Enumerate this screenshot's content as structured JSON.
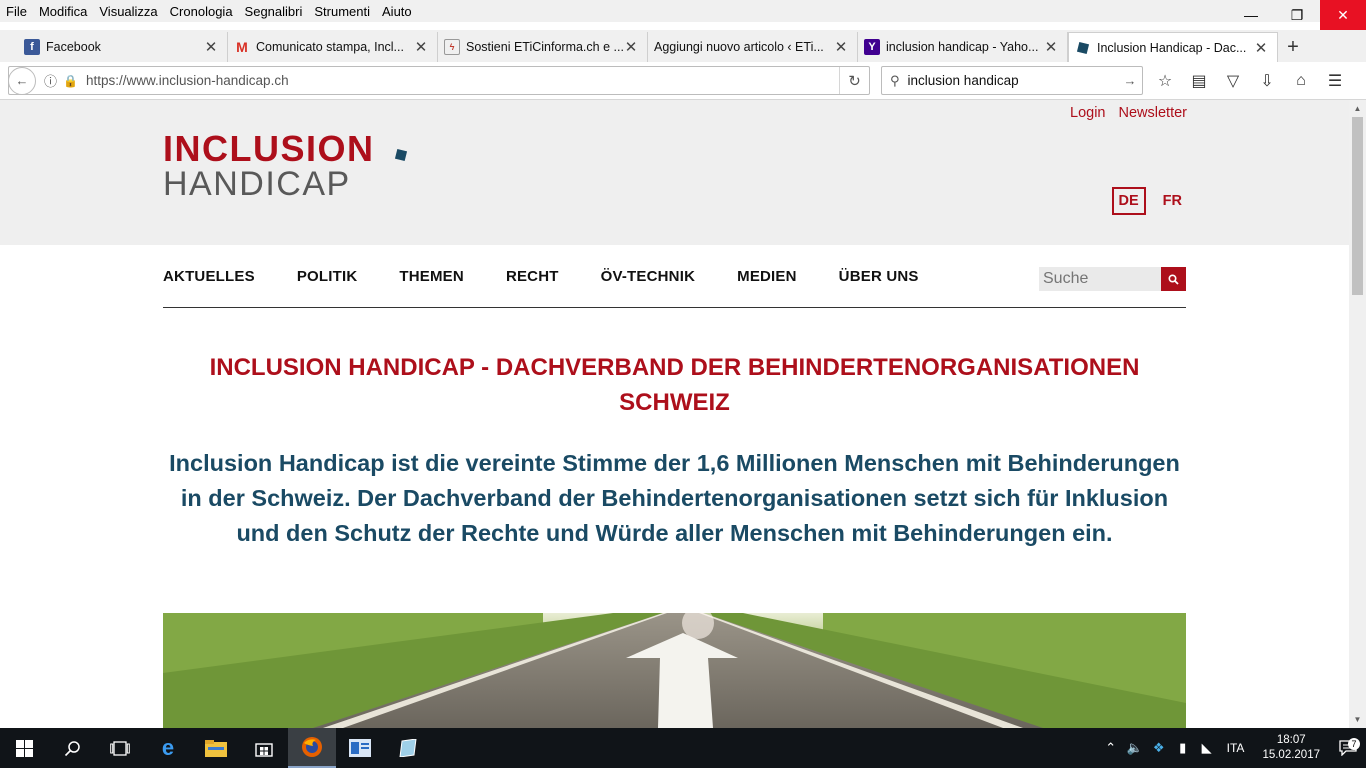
{
  "menu": [
    "File",
    "Modifica",
    "Visualizza",
    "Cronologia",
    "Segnalibri",
    "Strumenti",
    "Aiuto"
  ],
  "tabs": [
    {
      "label": "Facebook",
      "icon": "facebook-icon"
    },
    {
      "label": "Comunicato stampa, Incl...",
      "icon": "gmail-icon"
    },
    {
      "label": "Sostieni ETiCinforma.ch e ...",
      "icon": "eticinforma-icon"
    },
    {
      "label": "Aggiungi nuovo articolo ‹ ETi...",
      "icon": "wordpress-icon"
    },
    {
      "label": "inclusion handicap - Yaho...",
      "icon": "yahoo-icon"
    },
    {
      "label": "Inclusion Handicap - Dac...",
      "icon": "inclusion-handicap-icon"
    }
  ],
  "address": {
    "url": "https://www.inclusion-handicap.ch"
  },
  "search": {
    "value": "inclusion handicap"
  },
  "site": {
    "logo_top": "INCLUSION",
    "logo_bottom": "HANDICAP",
    "login": "Login",
    "newsletter": "Newsletter",
    "lang_de": "DE",
    "lang_fr": "FR",
    "nav": [
      "AKTUELLES",
      "POLITIK",
      "THEMEN",
      "RECHT",
      "ÖV-TECHNIK",
      "MEDIEN",
      "ÜBER UNS"
    ],
    "search_placeholder": "Suche",
    "headline": "INCLUSION HANDICAP - DACHVERBAND DER BEHINDERTENORGANISATIONEN SCHWEIZ",
    "intro": "Inclusion Handicap ist die vereinte Stimme der 1,6 Millionen Menschen mit Behinderungen in der Schweiz. Der Dachverband der Behindertenorganisationen setzt sich für Inklusion und den Schutz der Rechte und Würde aller Menschen mit Behinderungen ein."
  },
  "taskbar": {
    "language": "ITA",
    "time": "18:07",
    "date": "15.02.2017",
    "notifications": "7"
  },
  "colors": {
    "brand_red": "#ad0f1b",
    "brand_blue": "#1a4a64",
    "header_bg": "#efefef"
  }
}
